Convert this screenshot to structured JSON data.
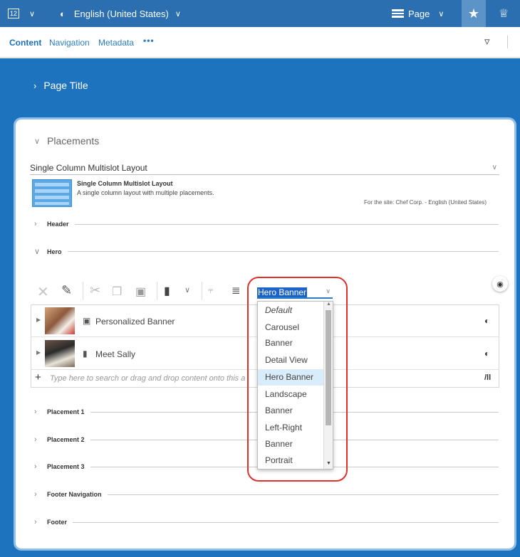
{
  "topbar": {
    "app_icon_text": "12",
    "language_label": "English (United States)",
    "page_label": "Page"
  },
  "tabs": {
    "content": "Content",
    "navigation": "Navigation",
    "metadata": "Metadata",
    "more": "•••"
  },
  "page_title_section": "Page Title",
  "placements": {
    "section_label": "Placements",
    "layout_select_value": "Single Column Multislot Layout",
    "layout_name": "Single Column Multislot Layout",
    "layout_description": "A single column layout with multiple placements.",
    "site_note": "For the site: Chef Corp. - English (United States)",
    "header_label": "Header",
    "hero_label": "Hero",
    "view_select_value": "Hero Banner",
    "items": [
      {
        "label": "Personalized Banner"
      },
      {
        "label": "Meet Sally"
      }
    ],
    "add_placeholder": "Type here to search or drag and drop content onto this a",
    "more_sections": [
      "Placement 1",
      "Placement 2",
      "Placement 3",
      "Footer Navigation",
      "Footer"
    ]
  },
  "dropdown_options": [
    "Default",
    "Carousel",
    "Banner",
    "Detail View",
    "Hero Banner",
    "Landscape",
    "Banner",
    "Left-Right",
    "Banner",
    "Portrait"
  ],
  "colors": {
    "brand_blue": "#2b6fb0",
    "page_blue": "#1e73be",
    "highlight_red": "#e0312b",
    "selected_bg": "#d9ecf9"
  }
}
